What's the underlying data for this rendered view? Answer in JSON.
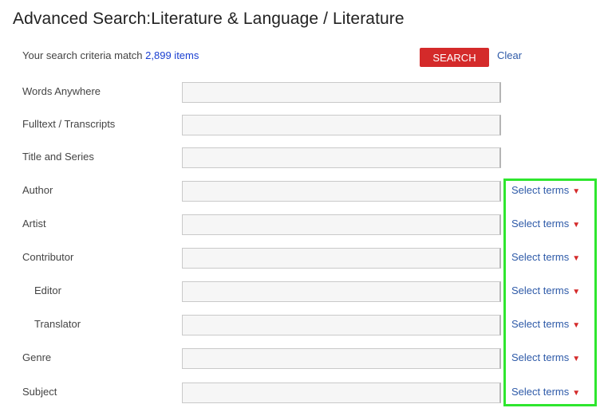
{
  "page": {
    "title": "Advanced Search:Literature & Language / Literature"
  },
  "summary": {
    "prefix": "Your search criteria match",
    "count": "2,899 items"
  },
  "actions": {
    "search_label": "SEARCH",
    "clear_label": "Clear"
  },
  "fields": [
    {
      "label": "Words Anywhere",
      "value": "",
      "has_terms": false
    },
    {
      "label": "Fulltext / Transcripts",
      "value": "",
      "has_terms": false
    },
    {
      "label": "Title and Series",
      "value": "",
      "has_terms": false
    },
    {
      "label": "Author",
      "value": "",
      "has_terms": true,
      "terms_label": "Select terms"
    },
    {
      "label": "Artist",
      "value": "",
      "has_terms": true,
      "terms_label": "Select terms"
    },
    {
      "label": "Contributor",
      "value": "",
      "has_terms": true,
      "terms_label": "Select terms"
    },
    {
      "label": "Editor",
      "value": "",
      "has_terms": true,
      "terms_label": "Select terms",
      "indent": true
    },
    {
      "label": "Translator",
      "value": "",
      "has_terms": true,
      "terms_label": "Select terms",
      "indent": true
    },
    {
      "label": "Genre",
      "value": "",
      "has_terms": true,
      "terms_label": "Select terms"
    },
    {
      "label": "Subject",
      "value": "",
      "has_terms": true,
      "terms_label": "Select terms"
    }
  ],
  "icons": {
    "terms_dropdown": "caret-down-icon"
  },
  "colors": {
    "search_button": "#d42a2a",
    "link": "#2e5aa8",
    "count": "#1a3fd1",
    "highlight": "#2ee62e"
  }
}
